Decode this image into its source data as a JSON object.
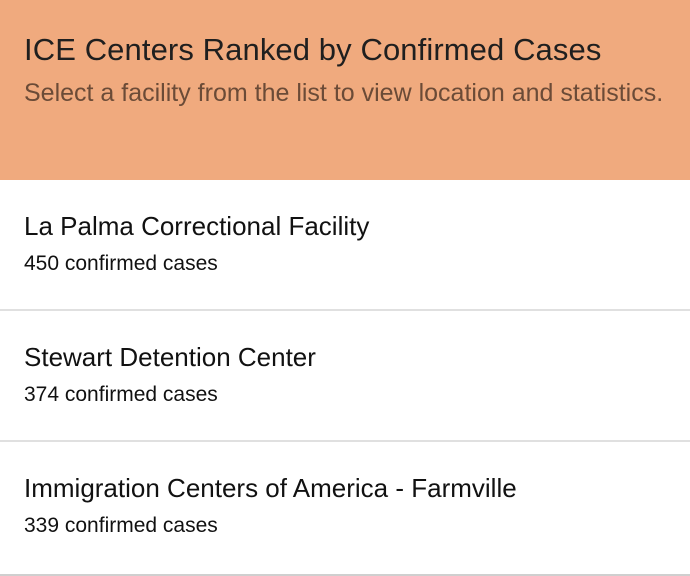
{
  "colors": {
    "header_background": "#f0aa7e",
    "header_title": "#1f1f1f",
    "header_subtitle": "#6b4b37",
    "divider": "#e0e0e0"
  },
  "header": {
    "title": "ICE Centers Ranked by Confirmed Cases",
    "subtitle": "Select a facility from the list to view location and statistics."
  },
  "facilities": [
    {
      "name": "La Palma Correctional Facility",
      "cases_text": "450 confirmed cases"
    },
    {
      "name": "Stewart Detention Center",
      "cases_text": "374 confirmed cases"
    },
    {
      "name": "Immigration Centers of America - Farmville",
      "cases_text": "339 confirmed cases"
    }
  ]
}
